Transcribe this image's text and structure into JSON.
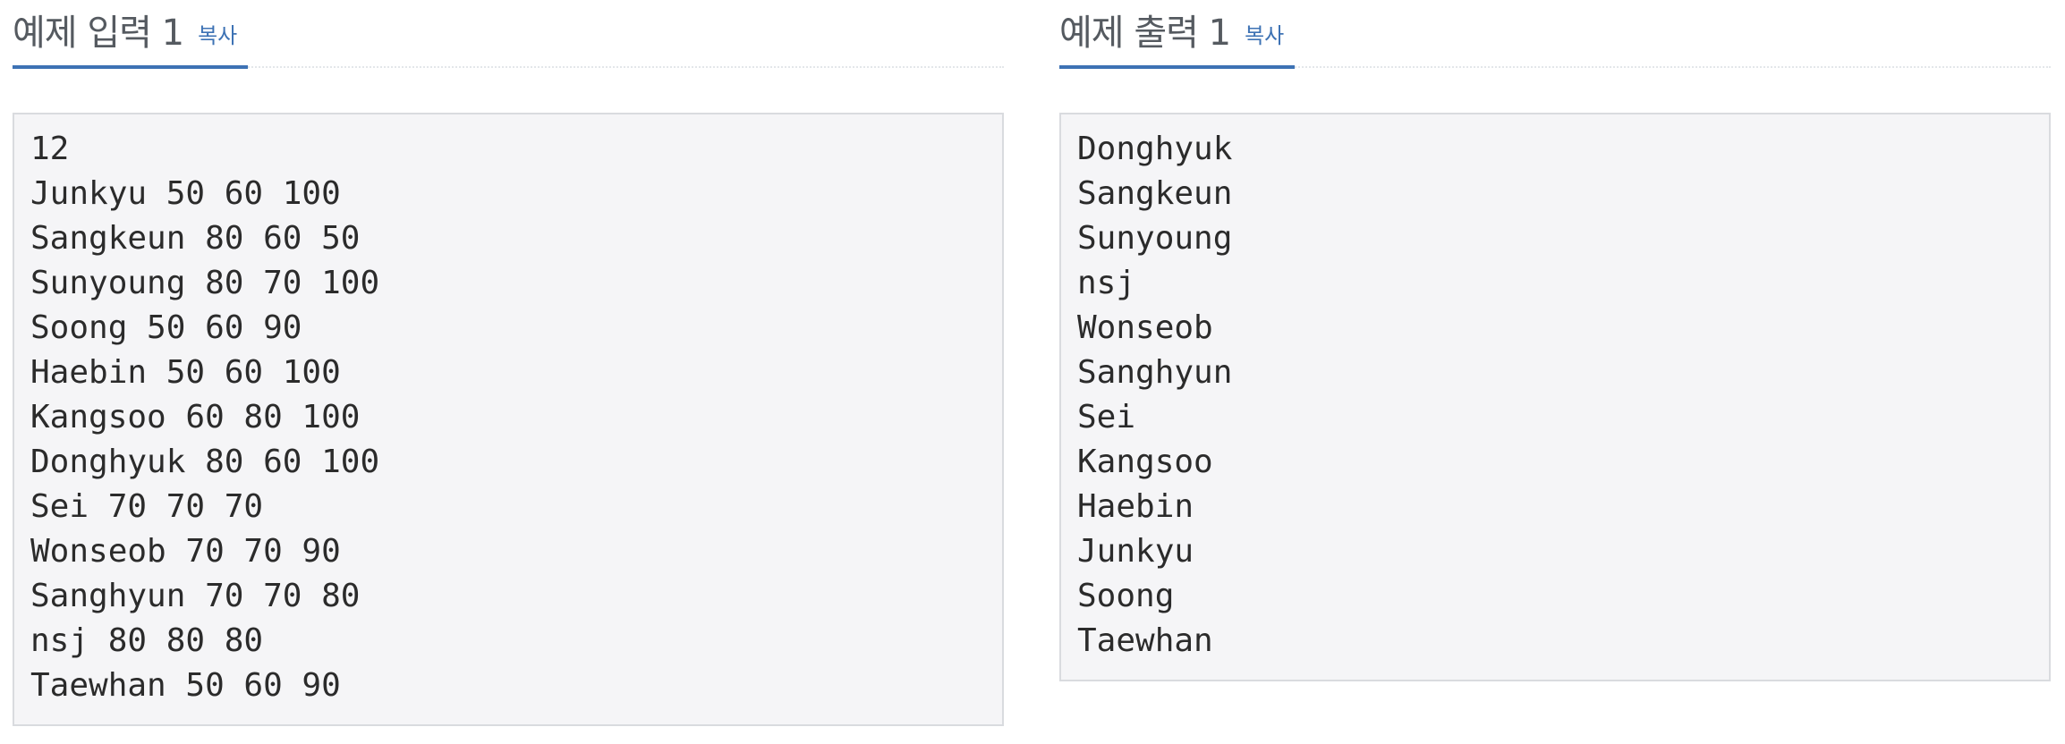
{
  "input": {
    "title": "예제 입력 1",
    "copy_label": "복사",
    "lines": [
      "12",
      "Junkyu 50 60 100",
      "Sangkeun 80 60 50",
      "Sunyoung 80 70 100",
      "Soong 50 60 90",
      "Haebin 50 60 100",
      "Kangsoo 60 80 100",
      "Donghyuk 80 60 100",
      "Sei 70 70 70",
      "Wonseob 70 70 90",
      "Sanghyun 70 70 80",
      "nsj 80 80 80",
      "Taewhan 50 60 90"
    ]
  },
  "output": {
    "title": "예제 출력 1",
    "copy_label": "복사",
    "lines": [
      "Donghyuk",
      "Sangkeun",
      "Sunyoung",
      "nsj",
      "Wonseob",
      "Sanghyun",
      "Sei",
      "Kangsoo",
      "Haebin",
      "Junkyu",
      "Soong",
      "Taewhan"
    ]
  },
  "colors": {
    "accent": "#3d72b4",
    "box_background": "#f5f5f7",
    "box_border": "#d9dbdf",
    "title_text": "#555a60"
  }
}
